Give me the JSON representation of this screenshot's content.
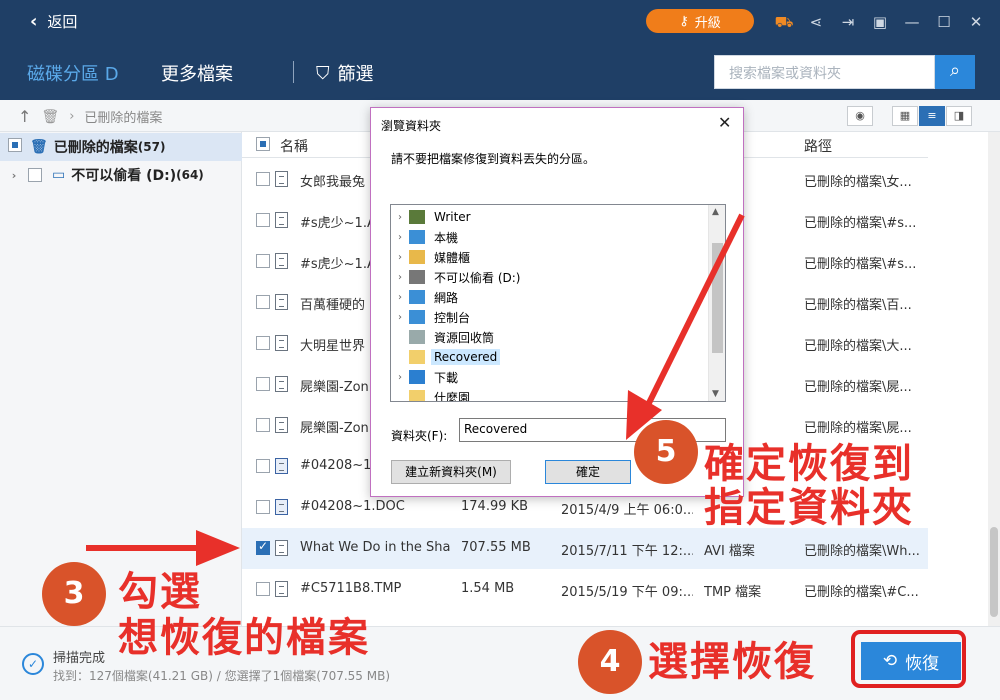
{
  "titlebar": {
    "back_label": "返回",
    "upgrade_label": "升級"
  },
  "header": {
    "tab_disk": "磁碟分區 D",
    "tab_more": "更多檔案",
    "tab_filter": "篩選",
    "search_placeholder": "搜索檔案或資料夾"
  },
  "breadcrumb": {
    "path": "已刪除的檔案"
  },
  "sidebar": {
    "items": [
      {
        "label": "已刪除的檔案",
        "count": "(57)"
      },
      {
        "label": "不可以偷看 (D:)",
        "count": "(64)"
      }
    ]
  },
  "table": {
    "headers": {
      "name": "名稱",
      "path": "路徑"
    },
    "rows": [
      {
        "name": "女郎我最兔",
        "size": "",
        "date": "",
        "type": "案",
        "path": "已刪除的檔案\\女..."
      },
      {
        "name": "#s虎少~1.A",
        "size": "",
        "date": "",
        "type": "案",
        "path": "已刪除的檔案\\#s..."
      },
      {
        "name": "#s虎少~1.A",
        "size": "",
        "date": "",
        "type": "案",
        "path": "已刪除的檔案\\#s..."
      },
      {
        "name": "百萬種硬的",
        "size": "",
        "date": "",
        "type": "檔案",
        "path": "已刪除的檔案\\百..."
      },
      {
        "name": "大明星世界",
        "size": "",
        "date": "",
        "type": "案",
        "path": "已刪除的檔案\\大..."
      },
      {
        "name": "屍樂園-Zon",
        "size": "",
        "date": "",
        "type": "案",
        "path": "已刪除的檔案\\屍..."
      },
      {
        "name": "屍樂園-Zon",
        "size": "",
        "date": "",
        "type": "案",
        "path": "已刪除的檔案\\屍..."
      },
      {
        "name": "#04208~1.",
        "size": "",
        "date": "",
        "type": "",
        "path": ""
      },
      {
        "name": "#04208~1.DOC",
        "size": "174.99 KB",
        "date": "2015/4/9 上午 06:0...",
        "type": "",
        "path": ""
      },
      {
        "name": "What We Do in the Sha...",
        "size": "707.55 MB",
        "date": "2015/7/11 下午 12:...",
        "type": "AVI 檔案",
        "path": "已刪除的檔案\\Wh..."
      },
      {
        "name": "#C5711B8.TMP",
        "size": "1.54 MB",
        "date": "2015/5/19 下午 09:...",
        "type": "TMP 檔案",
        "path": "已刪除的檔案\\#C..."
      }
    ]
  },
  "status": {
    "title": "掃描完成",
    "summary": "找到：127個檔案(41.21 GB) / 您選擇了1個檔案(707.55 MB)",
    "recover_label": "恢復"
  },
  "dialog": {
    "title": "瀏覽資料夾",
    "instruction": "請不要把檔案修復到資料丟失的分區。",
    "tree": [
      {
        "label": "Writer",
        "icon": "user-icon",
        "expand": true
      },
      {
        "label": "本機",
        "icon": "computer-icon",
        "expand": true
      },
      {
        "label": "媒體櫃",
        "icon": "library-icon",
        "expand": true
      },
      {
        "label": "不可以偷看 (D:)",
        "icon": "drive-icon",
        "expand": true
      },
      {
        "label": "網路",
        "icon": "network-icon",
        "expand": true
      },
      {
        "label": "控制台",
        "icon": "control-panel-icon",
        "expand": true
      },
      {
        "label": "資源回收筒",
        "icon": "recycle-bin-icon",
        "expand": false
      },
      {
        "label": "Recovered",
        "icon": "folder-icon",
        "expand": false
      },
      {
        "label": "下載",
        "icon": "download-icon",
        "expand": true
      },
      {
        "label": "什麼園",
        "icon": "folder-icon",
        "expand": false
      }
    ],
    "folder_label": "資料夾(F):",
    "folder_value": "Recovered",
    "new_folder_label": "建立新資料夾(M)",
    "ok_label": "確定"
  },
  "annotations": {
    "step3_num": "3",
    "step3_line1": "勾選",
    "step3_line2": "想恢復的檔案",
    "step4_num": "4",
    "step4_text": "選擇恢復",
    "step5_num": "5",
    "step5_line1": "確定恢復到",
    "step5_line2": "指定資料夾"
  },
  "colors": {
    "header_bg": "#1f3f66",
    "accent_blue": "#2b87da",
    "upgrade_orange": "#f07d1a",
    "annotation_red": "#e8302a",
    "annotation_circle": "#d9532a"
  }
}
